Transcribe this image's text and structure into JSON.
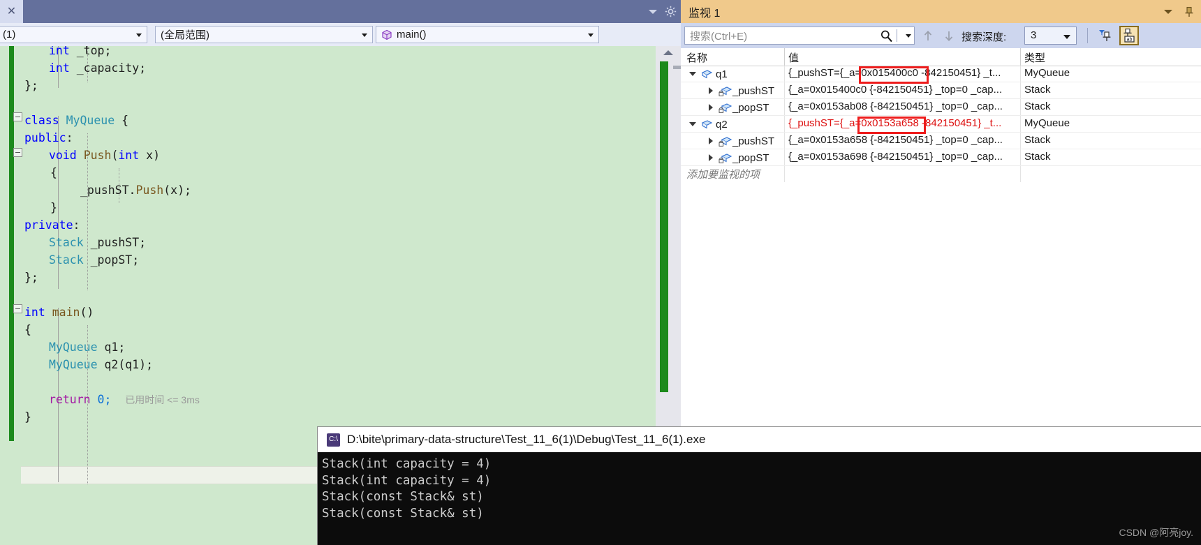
{
  "editor": {
    "tab_close_label": "✕",
    "navbar": {
      "scope_value": "(1)",
      "global_value": "(全局范围)",
      "member_value": "main()"
    },
    "code_lines": [
      {
        "id": "l1",
        "text": "int _top;"
      },
      {
        "id": "l2",
        "text": "int _capacity;"
      },
      {
        "id": "l3",
        "text": "};"
      },
      {
        "id": "l5",
        "text": "class MyQueue {"
      },
      {
        "id": "l6",
        "text": "public:"
      },
      {
        "id": "l7",
        "text": "void Push(int x)"
      },
      {
        "id": "l8",
        "text": "{"
      },
      {
        "id": "l9",
        "text": "_pushST.Push(x);"
      },
      {
        "id": "l10",
        "text": "}"
      },
      {
        "id": "l11",
        "text": "private:"
      },
      {
        "id": "l12",
        "text": "Stack _pushST;"
      },
      {
        "id": "l13",
        "text": "Stack _popST;"
      },
      {
        "id": "l14",
        "text": "};"
      },
      {
        "id": "l16",
        "text": "int main()"
      },
      {
        "id": "l17",
        "text": "{"
      },
      {
        "id": "l18",
        "text": "MyQueue q1;"
      },
      {
        "id": "l19",
        "text": "MyQueue q2(q1);"
      },
      {
        "id": "l21",
        "text": "return 0;"
      },
      {
        "id": "l22",
        "text": "}"
      }
    ],
    "tokens": {
      "int": "int",
      "top": "_top;",
      "capacity": "_capacity;",
      "brace_end": "};",
      "class": "class",
      "myqueue": "MyQueue",
      "brace_open": "{",
      "public": "public:",
      "void": "void",
      "push": "Push",
      "paren_int_x": "(int x)",
      "lbrace": "{",
      "pushst_call": "_pushST.",
      "push_call": "Push",
      "x_arg": "(x);",
      "rbrace": "}",
      "private": "private:",
      "stack": "Stack",
      "pushst_decl": "_pushST;",
      "popst_decl": "_popST;",
      "main": "main",
      "main_parens": "()",
      "q1_decl": "q1;",
      "q2_decl": "q2(q1);",
      "return": "return",
      "zero": "0;"
    },
    "elapsed_label": "已用时间 <= 3ms"
  },
  "watch": {
    "title": "监视 1",
    "search_placeholder": "搜索(Ctrl+E)",
    "depth_label": "搜索深度:",
    "depth_value": "3",
    "columns": [
      "名称",
      "值",
      "类型"
    ],
    "rows": [
      {
        "name": "q1",
        "indent": 0,
        "expander": "down",
        "icon": "object-icon",
        "value_prefix": "{_pushST={_a=",
        "value_highlight": "0x015400c0",
        "value_suffix": " -842150451} _t...",
        "type": "MyQueue",
        "modified": false,
        "highlighted": true
      },
      {
        "name": "_pushST",
        "indent": 1,
        "expander": "right",
        "icon": "private-object-icon",
        "value_prefix": "{_a=0x015400c0 {-842150451} _top=0 _cap...",
        "value_highlight": "",
        "value_suffix": "",
        "type": "Stack",
        "modified": false,
        "highlighted": false
      },
      {
        "name": "_popST",
        "indent": 1,
        "expander": "right",
        "icon": "private-object-icon",
        "value_prefix": "{_a=0x0153ab08 {-842150451} _top=0 _cap...",
        "value_highlight": "",
        "value_suffix": "",
        "type": "Stack",
        "modified": false,
        "highlighted": false
      },
      {
        "name": "q2",
        "indent": 0,
        "expander": "down",
        "icon": "object-icon",
        "value_prefix": "{_pushST={_a=",
        "value_highlight": "0x0153a658",
        "value_suffix": " -842150451} _t...",
        "type": "MyQueue",
        "modified": true,
        "highlighted": true
      },
      {
        "name": "_pushST",
        "indent": 1,
        "expander": "right",
        "icon": "private-object-icon",
        "value_prefix": "{_a=0x0153a658 {-842150451} _top=0 _cap...",
        "value_highlight": "",
        "value_suffix": "",
        "type": "Stack",
        "modified": false,
        "highlighted": false
      },
      {
        "name": "_popST",
        "indent": 1,
        "expander": "right",
        "icon": "private-object-icon",
        "value_prefix": "{_a=0x0153a698 {-842150451} _top=0 _cap...",
        "value_highlight": "",
        "value_suffix": "",
        "type": "Stack",
        "modified": false,
        "highlighted": false
      }
    ],
    "add_watch_placeholder": "添加要监视的项"
  },
  "console": {
    "title": "D:\\bite\\primary-data-structure\\Test_11_6(1)\\Debug\\Test_11_6(1).exe",
    "icon_label": "C:\\",
    "lines": [
      "Stack(int capacity = 4)",
      "Stack(int capacity = 4)",
      "Stack(const Stack& st)",
      "Stack(const Stack& st)"
    ]
  },
  "watermark": "CSDN @阿亮joy.",
  "colors": {
    "tab_strip": "#64709c",
    "editor_bg": "#cfe8cd",
    "watch_title": "#f0c98b",
    "watch_toolbar": "#cdd6ee",
    "change_bar": "#1c8a1c",
    "highlight_box": "#ee1c1c",
    "modified_value": "#dd1111",
    "console_bg": "#0c0c0c"
  }
}
